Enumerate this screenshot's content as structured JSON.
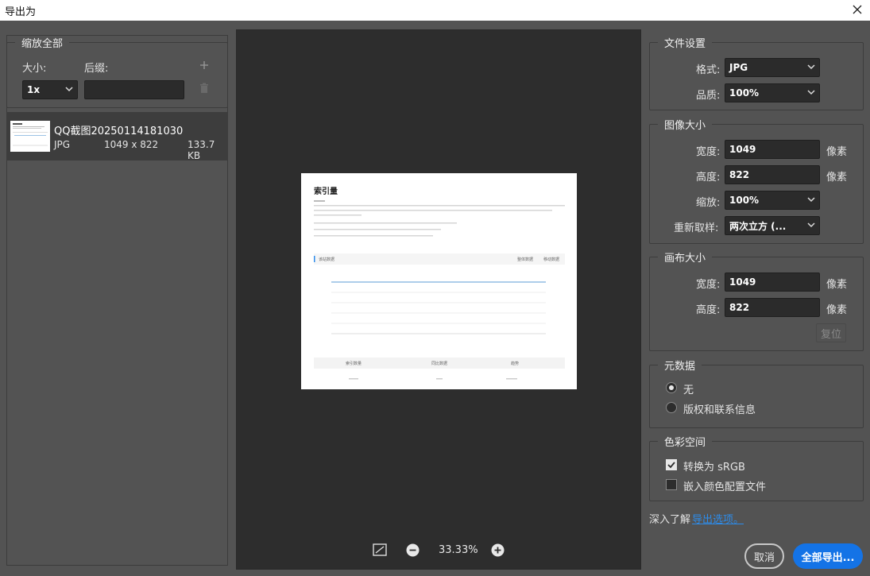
{
  "window": {
    "title": "导出为"
  },
  "left": {
    "scale_all_title": "缩放全部",
    "size_label": "大小:",
    "suffix_label": "后缀:",
    "size_value": "1x",
    "suffix_value": "",
    "file": {
      "name": "QQ截图20250114181030",
      "format": "JPG",
      "dimensions": "1049 x 822",
      "size": "133.7 KB"
    }
  },
  "preview": {
    "zoom": "33.33%",
    "doc": {
      "title": "索引量",
      "section_title": "该站数据",
      "tab_1": "整体数据",
      "tab_2": "移动数据",
      "table_headers": [
        "索引数量",
        "同比数据",
        "趋势"
      ]
    }
  },
  "file_settings": {
    "title": "文件设置",
    "format_label": "格式:",
    "format_value": "JPG",
    "quality_label": "品质:",
    "quality_value": "100%"
  },
  "image_size": {
    "title": "图像大小",
    "width_label": "宽度:",
    "width_value": "1049",
    "height_label": "高度:",
    "height_value": "822",
    "unit": "像素",
    "scale_label": "缩放:",
    "scale_value": "100%",
    "resample_label": "重新取样:",
    "resample_value": "两次立方 (..."
  },
  "canvas_size": {
    "title": "画布大小",
    "width_label": "宽度:",
    "width_value": "1049",
    "height_label": "高度:",
    "height_value": "822",
    "unit": "像素",
    "reset_label": "复位"
  },
  "metadata": {
    "title": "元数据",
    "option_none": "无",
    "option_copyright": "版权和联系信息",
    "selected": "无"
  },
  "color_space": {
    "title": "色彩空间",
    "convert_label": "转换为 sRGB",
    "convert_checked": true,
    "embed_label": "嵌入颜色配置文件",
    "embed_checked": false
  },
  "footer": {
    "learn_more": "深入了解",
    "export_options_link": "导出选项。",
    "cancel": "取消",
    "export_all": "全部导出..."
  },
  "colors": {
    "accent": "#1473e6",
    "link": "#2d8ceb",
    "panel": "#535353",
    "preview_bg": "#2d2d2d"
  }
}
